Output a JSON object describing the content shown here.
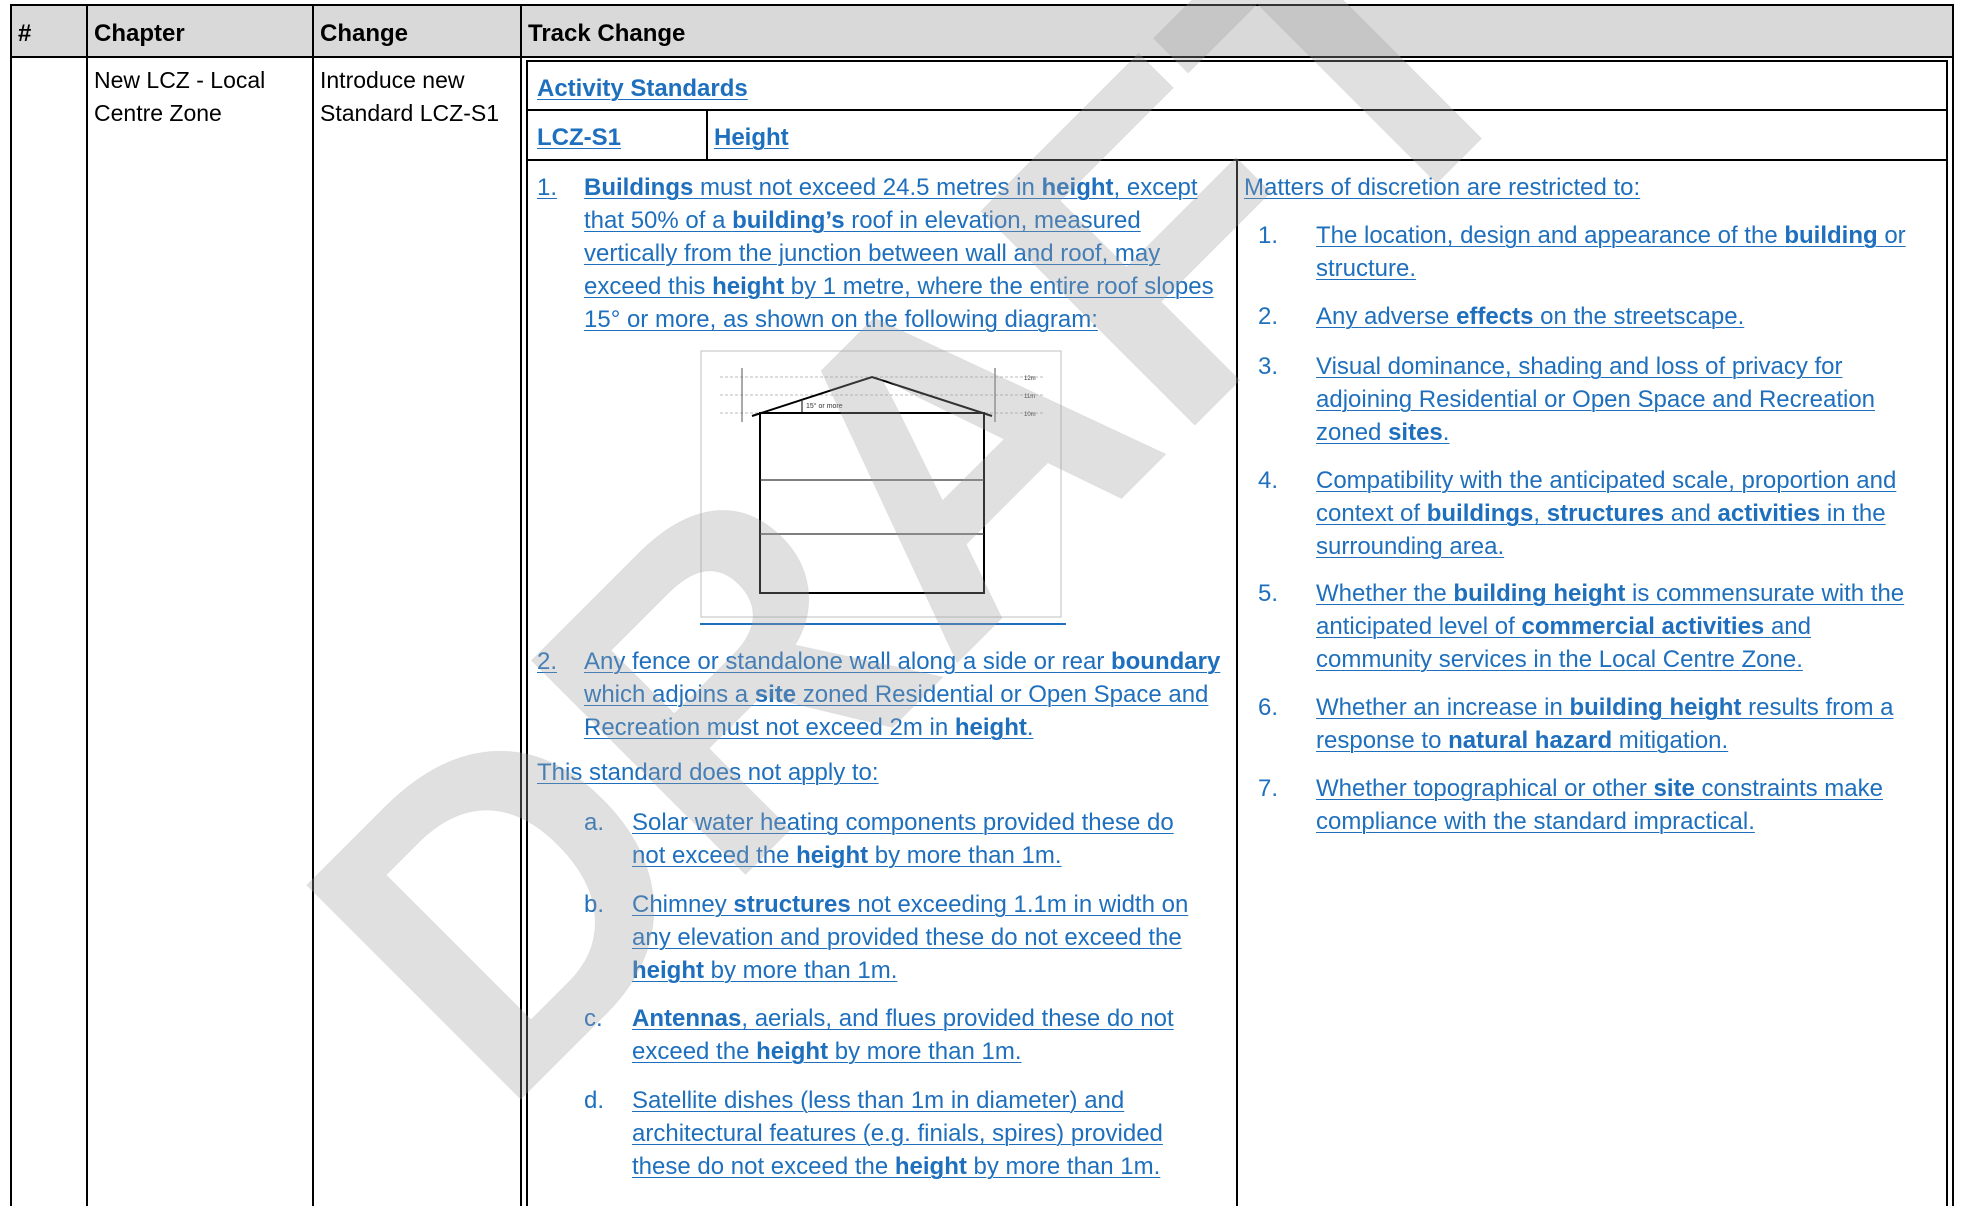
{
  "headers": {
    "num": "#",
    "chapter": "Chapter",
    "change": "Change",
    "track": "Track Change"
  },
  "row": {
    "chapter_l1": "New LCZ - Local",
    "chapter_l2": "Centre Zone",
    "change_l1": "Introduce new",
    "change_l2": "Standard LCZ-S1"
  },
  "standard": {
    "section_title": "Activity Standards",
    "code": "LCZ-S1",
    "title": "Height",
    "rule1": {
      "num": "1.",
      "lines": [
        [
          "",
          "Buildings",
          " must not exceed 24.5 metres in ",
          "height",
          ", except"
        ],
        [
          "that 50% of a ",
          "building’s",
          " roof in elevation, measured",
          "",
          ""
        ],
        [
          "vertically from the junction between wall and roof, may",
          "",
          "",
          "",
          ""
        ],
        [
          "exceed this ",
          "height",
          " by 1 metre, where the entire roof slopes",
          "",
          ""
        ],
        [
          "15° or more, as shown on the following diagram:",
          "",
          "",
          "",
          ""
        ]
      ]
    },
    "diagram": {
      "slope_label": "15° or more",
      "level_12": "12m",
      "level_11": "11m",
      "level_10": "10m"
    },
    "rule2": {
      "num": "2.",
      "lines": [
        [
          "Any fence or standalone wall along a side or rear ",
          "boundary",
          ""
        ],
        [
          "which adjoins a ",
          "site",
          " zoned Residential or Open Space and"
        ],
        [
          "Recreation must not exceed 2m in ",
          "height",
          "."
        ]
      ]
    },
    "exempt_intro": "This standard does not apply to:",
    "exemptions": [
      {
        "letter": "a.",
        "lines": [
          [
            "Solar water heating components provided these do",
            "",
            ""
          ],
          [
            "not exceed the ",
            "height",
            " by more than 1m."
          ]
        ]
      },
      {
        "letter": "b.",
        "lines": [
          [
            "Chimney ",
            "structures",
            " not exceeding 1.1m in width on"
          ],
          [
            "any elevation and provided these do not exceed the",
            "",
            ""
          ],
          [
            "",
            "height",
            " by more than 1m."
          ]
        ]
      },
      {
        "letter": "c.",
        "lines": [
          [
            "",
            "Antennas",
            ", aerials, and flues provided these do not"
          ],
          [
            "exceed the ",
            "height",
            " by more than 1m."
          ]
        ]
      },
      {
        "letter": "d.",
        "lines": [
          [
            "Satellite dishes (less than 1m in diameter) and",
            "",
            ""
          ],
          [
            "architectural features (e.g. finials, spires) provided",
            "",
            ""
          ],
          [
            "these do not exceed the ",
            "height",
            " by more than 1m."
          ]
        ]
      }
    ],
    "discretion_intro": "Matters of discretion are restricted to:",
    "matters": [
      {
        "num": "1.",
        "lines": [
          [
            "The location, design and appearance of the ",
            "building",
            " or"
          ],
          [
            "structure.",
            "",
            ""
          ]
        ]
      },
      {
        "num": "2.",
        "lines": [
          [
            "Any adverse ",
            "effects",
            " on the streetscape."
          ]
        ]
      },
      {
        "num": "3.",
        "lines": [
          [
            "Visual dominance, shading and loss of privacy for",
            "",
            ""
          ],
          [
            "adjoining Residential or Open Space and Recreation",
            "",
            ""
          ],
          [
            "zoned ",
            "sites",
            "."
          ]
        ]
      },
      {
        "num": "4.",
        "lines": [
          [
            "Compatibility with the anticipated scale, proportion and",
            "",
            ""
          ],
          [
            "context of ",
            "buildings",
            ", "
          ],
          [
            "surrounding area.",
            "",
            ""
          ]
        ]
      },
      {
        "num": "5.",
        "lines": [
          [
            "Whether the ",
            "building height",
            " is commensurate with the"
          ],
          [
            "anticipated level of ",
            "commercial activities",
            " and"
          ],
          [
            "community services in the Local Centre Zone.",
            "",
            ""
          ]
        ]
      },
      {
        "num": "6.",
        "lines": [
          [
            "Whether an increase in ",
            "building height",
            " results from a"
          ],
          [
            "response to ",
            "natural hazard",
            " mitigation."
          ]
        ]
      },
      {
        "num": "7.",
        "lines": [
          [
            "Whether topographical or other ",
            "site",
            " constraints make"
          ],
          [
            "compliance with the standard impractical.",
            "",
            ""
          ]
        ]
      }
    ],
    "matter4_line2_extra": {
      "structures": "structures",
      "and": " and ",
      "activities": "activities",
      "tail": " in the"
    }
  },
  "watermark_text": "DRAFT"
}
